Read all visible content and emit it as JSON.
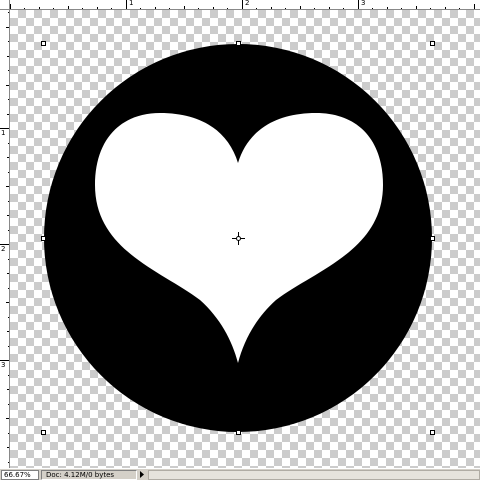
{
  "rulers": {
    "top_numbers": [
      "1",
      "2",
      "3"
    ],
    "left_numbers": [
      "1",
      "2",
      "3"
    ]
  },
  "status_bar": {
    "zoom": "66.67%",
    "doc_info": "Doc: 4.12M/0 bytes",
    "menu_icon": "triangle-right-icon"
  },
  "colors": {
    "circle": "#000000",
    "heart": "#ffffff",
    "checker_light": "#ffffff",
    "checker_dark": "#cccccc",
    "chrome": "#d4d0c8"
  },
  "icons": {
    "center_marker": "crosshair-icon",
    "selection_handles": "transform-handle-icon"
  }
}
